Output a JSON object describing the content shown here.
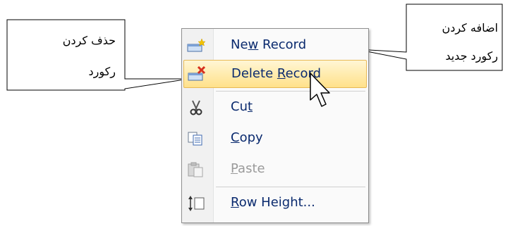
{
  "menu": {
    "items": [
      {
        "pre": "Ne",
        "key": "w",
        "post": " Record",
        "icon": "new-record-icon"
      },
      {
        "pre": "Delete ",
        "key": "R",
        "post": "ecord",
        "icon": "delete-record-icon",
        "highlighted": true
      },
      {
        "pre": "Cu",
        "key": "t",
        "post": "",
        "icon": "scissors-icon"
      },
      {
        "pre": "",
        "key": "C",
        "post": "opy",
        "icon": "copy-icon"
      },
      {
        "pre": "",
        "key": "P",
        "post": "aste",
        "icon": "paste-icon",
        "disabled": true
      },
      {
        "pre": "",
        "key": "R",
        "post": "ow Height...",
        "icon": "row-height-icon"
      }
    ]
  },
  "callouts": {
    "delete": {
      "line1": "حذف کردن",
      "line2": "رکورد"
    },
    "add": {
      "line1": "اضافه کردن",
      "line2": "رکورد جدید"
    }
  },
  "colors": {
    "highlight": "#ffe18a",
    "label": "#0a2a6e",
    "disabled": "#9a9a9a"
  }
}
